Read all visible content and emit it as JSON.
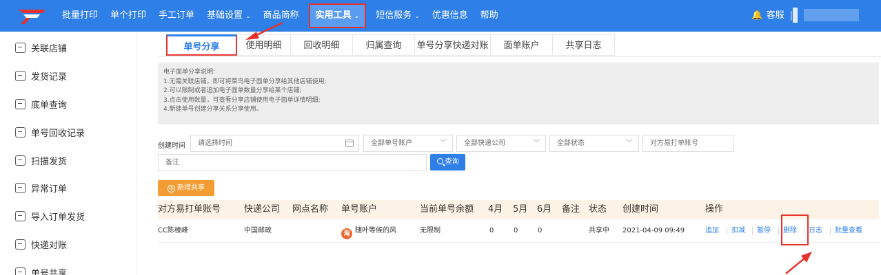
{
  "topbar": {
    "nav": [
      {
        "label": "批量打印"
      },
      {
        "label": "单个打印"
      },
      {
        "label": "手工订单"
      },
      {
        "label": "基础设置",
        "caret": "⌄"
      },
      {
        "label": "商品简称"
      },
      {
        "label": "实用工具",
        "caret": "⌄",
        "active": true
      },
      {
        "label": "短信服务",
        "caret": "⌄"
      },
      {
        "label": "优惠信息"
      },
      {
        "label": "帮助"
      }
    ],
    "service": "客服",
    "bell": "🔔",
    "separator": "|"
  },
  "sidebar": {
    "items": [
      {
        "label": "关联店铺"
      },
      {
        "label": "发货记录"
      },
      {
        "label": "底单查询"
      },
      {
        "label": "单号回收记录"
      },
      {
        "label": "扫描发货"
      },
      {
        "label": "异常订单"
      },
      {
        "label": "导入订单发货"
      },
      {
        "label": "快递对账"
      },
      {
        "label": "单号共享"
      }
    ]
  },
  "tabs": [
    {
      "label": "单号分享",
      "active": true
    },
    {
      "label": "使用明细"
    },
    {
      "label": "回收明细"
    },
    {
      "label": "归属查询"
    },
    {
      "label": "单号分享快递对账"
    },
    {
      "label": "面单账户"
    },
    {
      "label": "共享日志"
    }
  ],
  "notice": {
    "title": "电子面单分享说明:",
    "lines": [
      "1.无需关联店铺，即可将菜鸟电子面单分享给其他店铺使用;",
      "2.可以限制或者追加电子面单数量分享给某个店铺;",
      "3.点击使用数量，可查看分享店铺使用电子面单详情明细;",
      "4.新建单号创建分享关系分享使用。"
    ]
  },
  "filters": {
    "created_time_label": "创建时间",
    "time_placeholder": "请选择时间",
    "account_select": "全部单号账户",
    "express_select": "全部快递公司",
    "status_select": "全部状态",
    "partner_account_placeholder": "对方易打单账号",
    "remark_placeholder": "备注",
    "search_label": "查询",
    "chevron": "﹀"
  },
  "add_button": {
    "label": "新增共享",
    "icon": "+"
  },
  "table": {
    "columns": [
      "对方易打单账号",
      "快递公司",
      "网点名称",
      "单号账户",
      "当前单号余额",
      "4月",
      "5月",
      "6月",
      "备注",
      "状态",
      "创建时间",
      "操作"
    ],
    "rows": [
      {
        "partner_account": "CC陈棱峰",
        "express": "中国邮政",
        "branch": "",
        "account_icon": "淘",
        "account": "随叶等候的风",
        "balance": "无限制",
        "apr": "0",
        "may": "0",
        "jun": "0",
        "remark": "",
        "status": "共享中",
        "created": "2021-04-09 09:49",
        "ops": [
          "追加",
          "扣减",
          "暂停",
          "删除",
          "日志",
          "批量查看"
        ]
      }
    ]
  },
  "colors": {
    "primary": "#2e7fe8",
    "highlight": "#e5322d",
    "orange": "#f39c33",
    "table_header": "#fcf3e6"
  }
}
